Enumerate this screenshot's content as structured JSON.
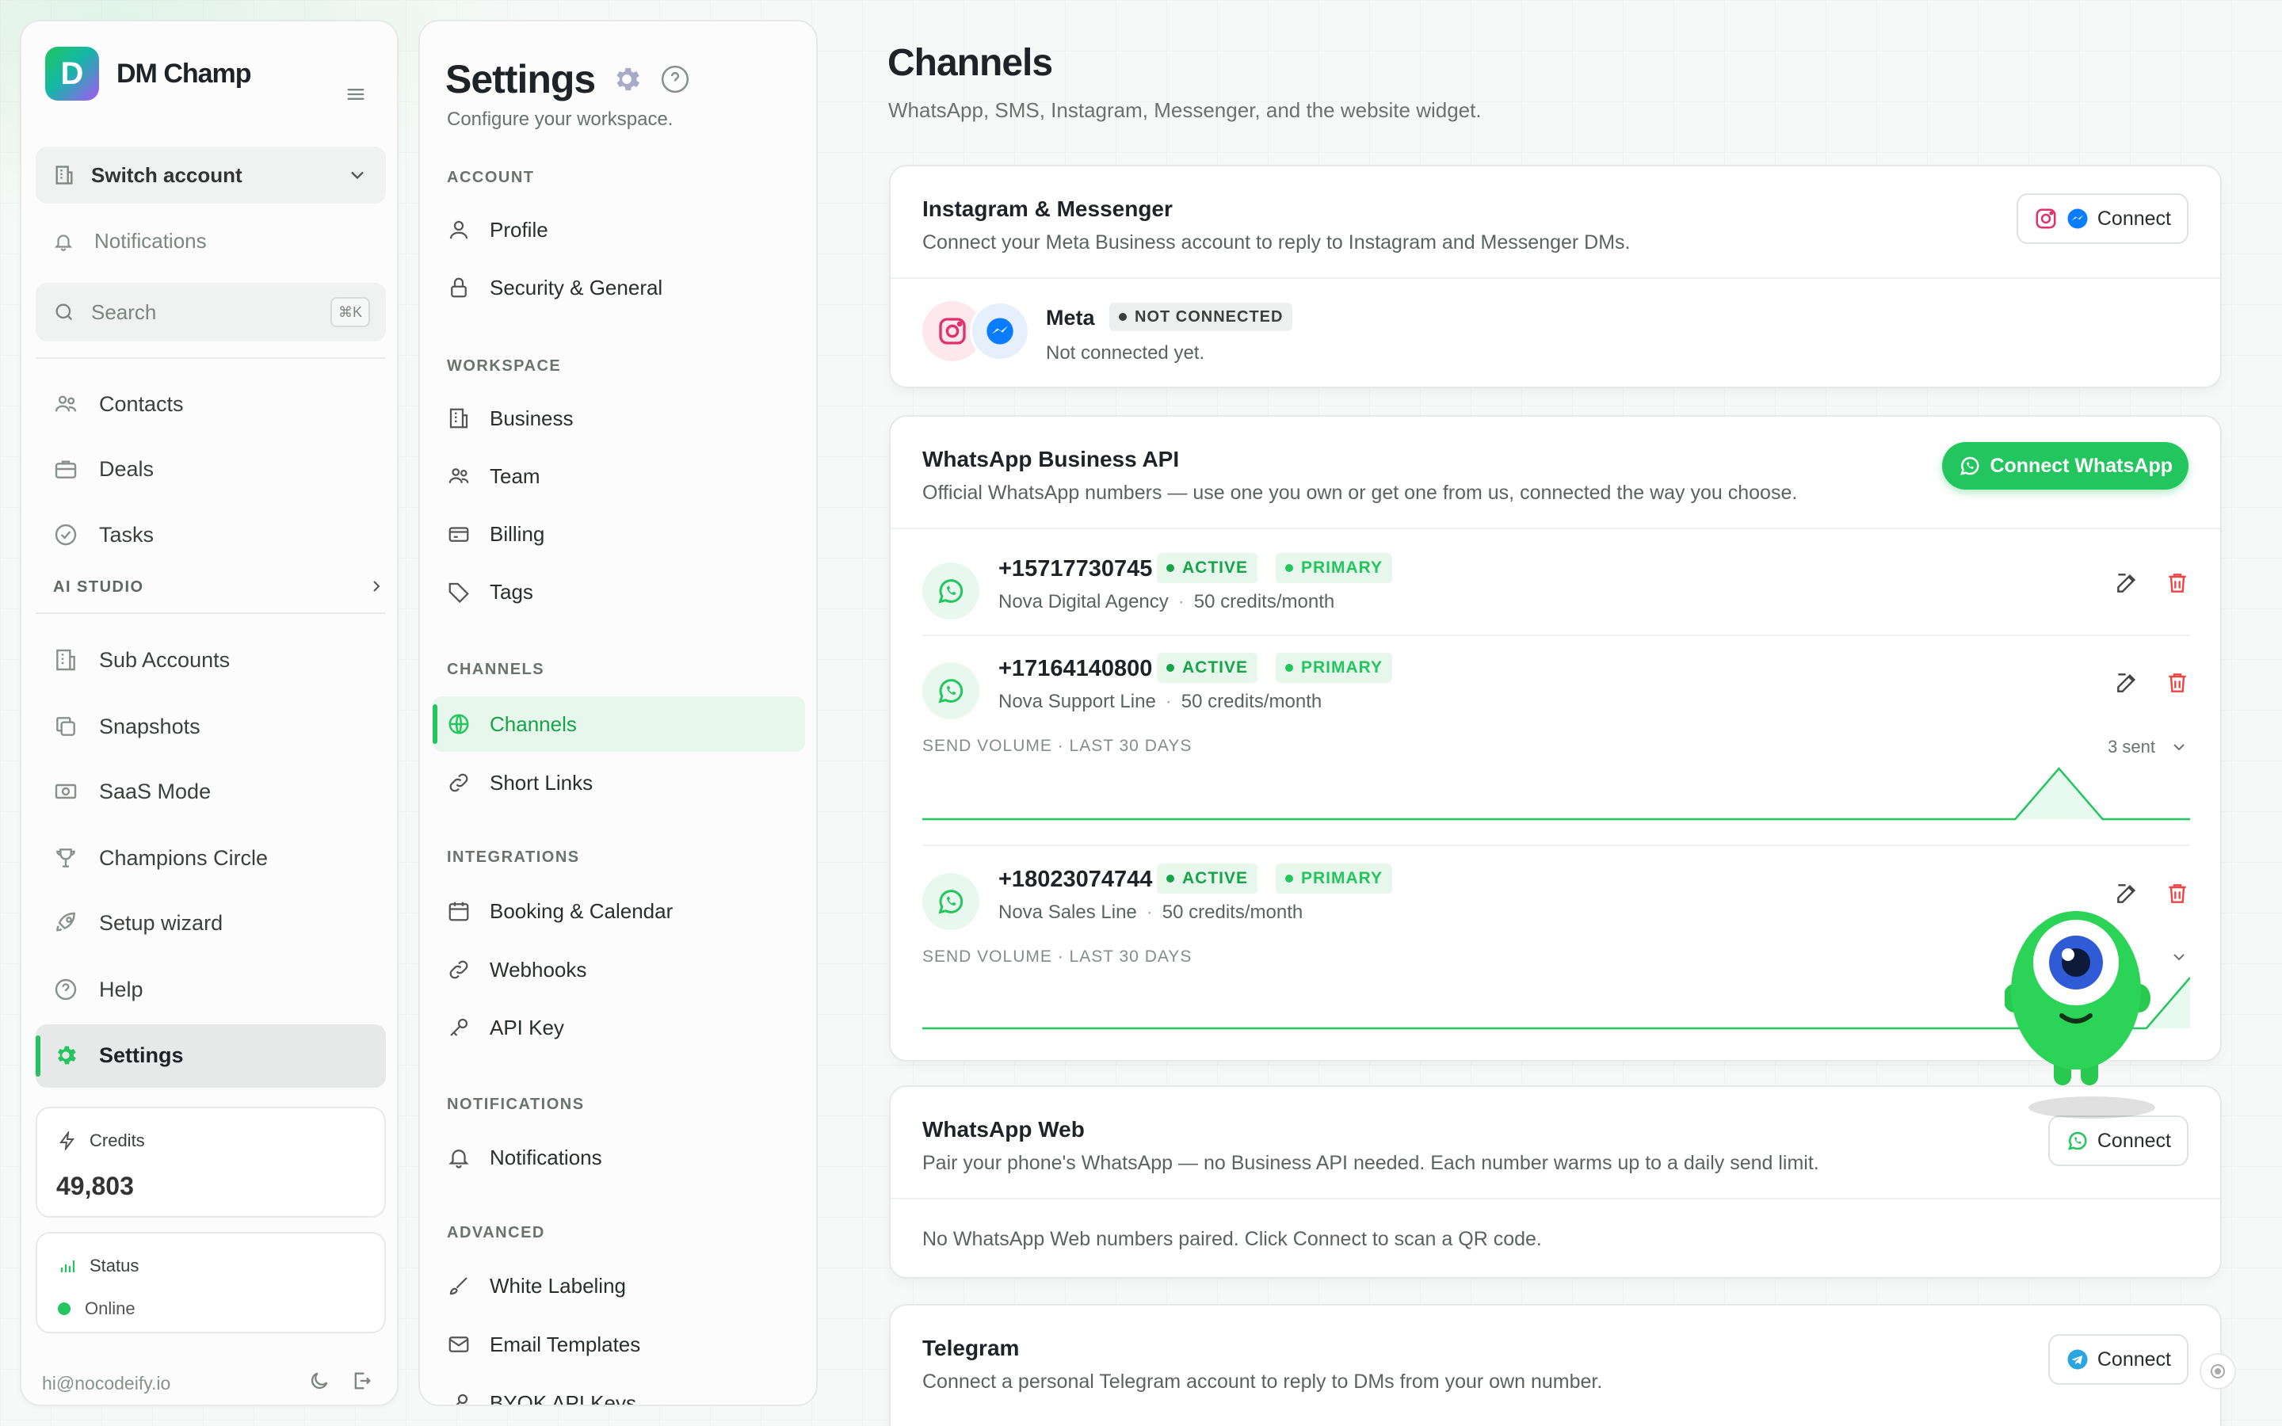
{
  "brand": {
    "name": "DM Champ",
    "logo_letter": "D"
  },
  "sidebar": {
    "switch_account": "Switch account",
    "notifications": "Notifications",
    "search_placeholder": "Search",
    "search_shortcut": "⌘K",
    "items_top": [
      {
        "label": "Contacts",
        "icon": "contacts-icon"
      },
      {
        "label": "Deals",
        "icon": "briefcase-icon"
      },
      {
        "label": "Tasks",
        "icon": "check-circle-icon"
      }
    ],
    "section_ai": "AI STUDIO",
    "items_bottom": [
      {
        "label": "Sub Accounts",
        "icon": "building-icon"
      },
      {
        "label": "Snapshots",
        "icon": "copy-icon"
      },
      {
        "label": "SaaS Mode",
        "icon": "money-icon"
      },
      {
        "label": "Champions Circle",
        "icon": "trophy-icon"
      },
      {
        "label": "Setup wizard",
        "icon": "rocket-icon"
      },
      {
        "label": "Help",
        "icon": "help-icon"
      },
      {
        "label": "Settings",
        "icon": "gear-icon",
        "active": true
      }
    ],
    "credits_label": "Credits",
    "credits_value": "49,803",
    "status_label": "Status",
    "status_value": "Online",
    "email": "hi@nocodeify.io"
  },
  "settings": {
    "title": "Settings",
    "subtitle": "Configure your workspace.",
    "sections": {
      "account": "ACCOUNT",
      "workspace": "WORKSPACE",
      "channels": "CHANNELS",
      "integrations": "INTEGRATIONS",
      "notifications": "NOTIFICATIONS",
      "advanced": "ADVANCED"
    },
    "items": {
      "profile": "Profile",
      "security": "Security & General",
      "business": "Business",
      "team": "Team",
      "billing": "Billing",
      "tags": "Tags",
      "channels": "Channels",
      "short_links": "Short Links",
      "booking": "Booking & Calendar",
      "webhooks": "Webhooks",
      "api_key": "API Key",
      "notifications": "Notifications",
      "white_labeling": "White Labeling",
      "email_templates": "Email Templates",
      "byok": "BYOK API Keys"
    }
  },
  "main": {
    "title": "Channels",
    "subtitle": "WhatsApp, SMS, Instagram, Messenger, and the website widget.",
    "instagram": {
      "title": "Instagram & Messenger",
      "desc": "Connect your Meta Business account to reply to Instagram and Messenger DMs.",
      "connect": "Connect",
      "account_name": "Meta",
      "status_badge": "NOT CONNECTED",
      "status_text": "Not connected yet."
    },
    "whatsapp_api": {
      "title": "WhatsApp Business API",
      "desc": "Official WhatsApp numbers — use one you own or get one from us, connected the way you choose.",
      "connect": "Connect WhatsApp",
      "badge_active": "ACTIVE",
      "badge_primary": "PRIMARY",
      "volume_label": "SEND VOLUME · LAST 30 DAYS",
      "numbers": [
        {
          "number": "+15717730745",
          "name": "Nova Digital Agency",
          "credits": "50 credits/month"
        },
        {
          "number": "+17164140800",
          "name": "Nova Support Line",
          "credits": "50 credits/month",
          "sent": "3 sent"
        },
        {
          "number": "+18023074744",
          "name": "Nova Sales Line",
          "credits": "50 credits/month"
        }
      ]
    },
    "whatsapp_web": {
      "title": "WhatsApp Web",
      "desc": "Pair your phone's WhatsApp — no Business API needed. Each number warms up to a daily send limit.",
      "connect": "Connect",
      "empty": "No WhatsApp Web numbers paired. Click Connect to scan a QR code."
    },
    "telegram": {
      "title": "Telegram",
      "desc": "Connect a personal Telegram account to reply to DMs from your own number.",
      "connect": "Connect"
    }
  },
  "colors": {
    "accent": "#22c55e",
    "danger": "#ef4444",
    "instagram": "#e1306c",
    "messenger": "#0a7cff",
    "telegram": "#2aa5e0"
  },
  "sparklines": {
    "row2_daily_sends": [
      0,
      0,
      0,
      0,
      0,
      0,
      0,
      0,
      0,
      0,
      0,
      0,
      0,
      0,
      0,
      0,
      0,
      0,
      0,
      0,
      0,
      0,
      0,
      0,
      0,
      0,
      3,
      0,
      0,
      0
    ],
    "row3_daily_sends": [
      0,
      0,
      0,
      0,
      0,
      0,
      0,
      0,
      0,
      0,
      0,
      0,
      0,
      0,
      0,
      0,
      0,
      0,
      0,
      0,
      0,
      0,
      0,
      0,
      0,
      0,
      0,
      0,
      0,
      1
    ]
  }
}
